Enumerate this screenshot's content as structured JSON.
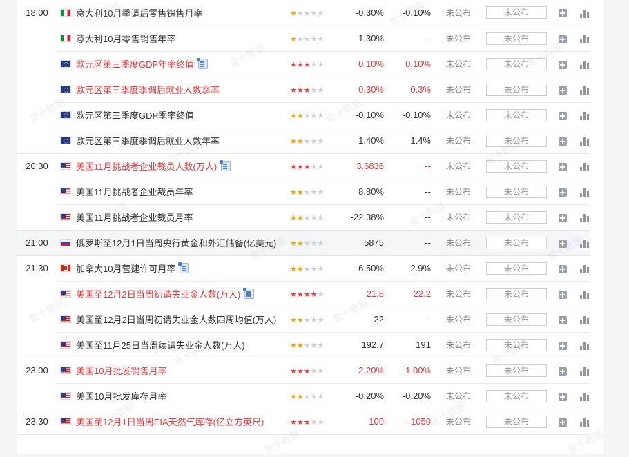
{
  "pending_value": "未公布",
  "watermark_text": "金十数据",
  "rows": [
    {
      "time": "18:00",
      "flag": "it",
      "event": "意大利10月季调后零售销售月率",
      "stars": 1,
      "prev": "-0.30%",
      "forecast": "-0.10%",
      "actual": "未公布",
      "hl": false,
      "doc": false,
      "end": false,
      "alt": false
    },
    {
      "time": "",
      "flag": "it",
      "event": "意大利10月零售销售年率",
      "stars": 1,
      "prev": "1.30%",
      "forecast": "--",
      "actual": "未公布",
      "hl": false,
      "doc": false,
      "end": false,
      "alt": false
    },
    {
      "time": "",
      "flag": "eu",
      "event": "欧元区第三季度GDP年率终值",
      "stars": 3,
      "prev": "0.10%",
      "forecast": "0.10%",
      "actual": "未公布",
      "hl": true,
      "doc": true,
      "end": false,
      "alt": false
    },
    {
      "time": "",
      "flag": "eu",
      "event": "欧元区第三季度季调后就业人数季率",
      "stars": 3,
      "prev": "0.30%",
      "forecast": "0.3%",
      "actual": "未公布",
      "hl": true,
      "doc": false,
      "end": false,
      "alt": false
    },
    {
      "time": "",
      "flag": "eu",
      "event": "欧元区第三季度GDP季率终值",
      "stars": 2,
      "prev": "-0.10%",
      "forecast": "-0.10%",
      "actual": "未公布",
      "hl": false,
      "doc": false,
      "end": false,
      "alt": false
    },
    {
      "time": "",
      "flag": "eu",
      "event": "欧元区第三季度季调后就业人数年率",
      "stars": 2,
      "prev": "1.40%",
      "forecast": "1.4%",
      "actual": "未公布",
      "hl": false,
      "doc": false,
      "end": true,
      "alt": false
    },
    {
      "time": "20:30",
      "flag": "us",
      "event": "美国11月挑战者企业裁员人数(万人)",
      "stars": 3,
      "prev": "3.6836",
      "forecast": "--",
      "actual": "未公布",
      "hl": true,
      "doc": true,
      "end": false,
      "alt": false
    },
    {
      "time": "",
      "flag": "us",
      "event": "美国11月挑战者企业裁员年率",
      "stars": 2,
      "prev": "8.80%",
      "forecast": "--",
      "actual": "未公布",
      "hl": false,
      "doc": false,
      "end": false,
      "alt": false
    },
    {
      "time": "",
      "flag": "us",
      "event": "美国11月挑战者企业裁员月率",
      "stars": 2,
      "prev": "-22.38%",
      "forecast": "--",
      "actual": "未公布",
      "hl": false,
      "doc": false,
      "end": true,
      "alt": false
    },
    {
      "time": "21:00",
      "flag": "ru",
      "event": "俄罗斯至12月1日当周央行黄金和外汇储备(亿美元)",
      "stars": 2,
      "prev": "5875",
      "forecast": "--",
      "actual": "未公布",
      "hl": false,
      "doc": false,
      "end": true,
      "alt": true
    },
    {
      "time": "21:30",
      "flag": "ca",
      "event": "加拿大10月营建许可月率",
      "stars": 2,
      "prev": "-6.50%",
      "forecast": "2.9%",
      "actual": "未公布",
      "hl": false,
      "doc": true,
      "end": false,
      "alt": false
    },
    {
      "time": "",
      "flag": "us",
      "event": "美国至12月2日当周初请失业金人数(万人)",
      "stars": 4,
      "prev": "21.8",
      "forecast": "22.2",
      "actual": "未公布",
      "hl": true,
      "doc": true,
      "end": false,
      "alt": false
    },
    {
      "time": "",
      "flag": "us",
      "event": "美国至12月2日当周初请失业金人数四周均值(万人)",
      "stars": 2,
      "prev": "22",
      "forecast": "--",
      "actual": "未公布",
      "hl": false,
      "doc": false,
      "end": false,
      "alt": false
    },
    {
      "time": "",
      "flag": "us",
      "event": "美国至11月25日当周续请失业金人数(万人)",
      "stars": 2,
      "prev": "192.7",
      "forecast": "191",
      "actual": "未公布",
      "hl": false,
      "doc": false,
      "end": true,
      "alt": false
    },
    {
      "time": "23:00",
      "flag": "us",
      "event": "美国10月批发销售月率",
      "stars": 3,
      "prev": "2.20%",
      "forecast": "1.00%",
      "actual": "未公布",
      "hl": true,
      "doc": false,
      "end": false,
      "alt": false
    },
    {
      "time": "",
      "flag": "us",
      "event": "美国10月批发库存月率",
      "stars": 2,
      "prev": "-0.20%",
      "forecast": "-0.20%",
      "actual": "未公布",
      "hl": false,
      "doc": false,
      "end": true,
      "alt": false
    },
    {
      "time": "23:30",
      "flag": "us",
      "event": "美国至12月1日当周EIA天然气库存(亿立方英尺)",
      "stars": 3,
      "prev": "100",
      "forecast": "-1050",
      "actual": "未公布",
      "hl": true,
      "doc": false,
      "end": true,
      "alt": false
    }
  ]
}
